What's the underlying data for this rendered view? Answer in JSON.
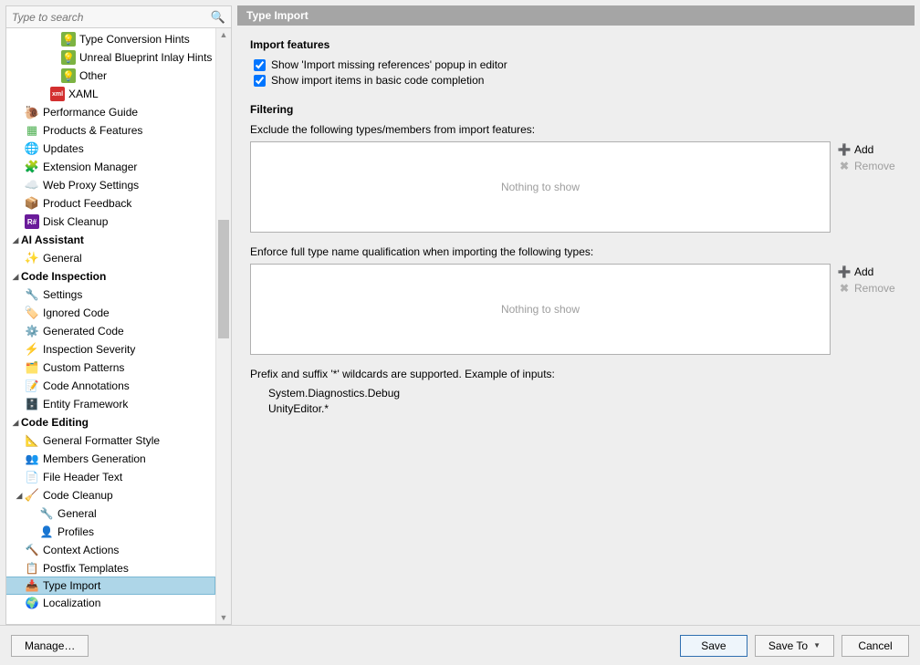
{
  "search": {
    "placeholder": "Type to search"
  },
  "tree": {
    "type_conversion_hints": "Type Conversion Hints",
    "unreal_inlay_hints": "Unreal Blueprint Inlay Hints",
    "other": "Other",
    "xaml": "XAML",
    "performance_guide": "Performance Guide",
    "products_features": "Products & Features",
    "updates": "Updates",
    "extension_manager": "Extension Manager",
    "web_proxy": "Web Proxy Settings",
    "product_feedback": "Product Feedback",
    "disk_cleanup": "Disk Cleanup",
    "ai_assistant": "AI Assistant",
    "ai_general": "General",
    "code_inspection": "Code Inspection",
    "ci_settings": "Settings",
    "ci_ignored": "Ignored Code",
    "ci_generated": "Generated Code",
    "ci_severity": "Inspection Severity",
    "ci_patterns": "Custom Patterns",
    "ci_annotations": "Code Annotations",
    "ci_ef": "Entity Framework",
    "code_editing": "Code Editing",
    "ce_formatter": "General Formatter Style",
    "ce_members": "Members Generation",
    "ce_file_header": "File Header Text",
    "ce_cleanup": "Code Cleanup",
    "ce_cleanup_general": "General",
    "ce_cleanup_profiles": "Profiles",
    "ce_context_actions": "Context Actions",
    "ce_postfix": "Postfix Templates",
    "ce_type_import": "Type Import",
    "ce_localization": "Localization"
  },
  "header": {
    "title": "Type Import"
  },
  "main": {
    "section_import_features": "Import features",
    "check1": "Show 'Import missing references' popup in editor",
    "check2": "Show import items in basic code completion",
    "section_filtering": "Filtering",
    "exclude_desc": "Exclude the following types/members from import features:",
    "nothing_to_show": "Nothing to show",
    "add_label": "Add",
    "remove_label": "Remove",
    "enforce_desc": "Enforce full type name qualification when importing the following types:",
    "hint": "Prefix and suffix '*' wildcards are supported. Example of inputs:",
    "example1": "System.Diagnostics.Debug",
    "example2": "UnityEditor.*"
  },
  "footer": {
    "manage": "Manage…",
    "save": "Save",
    "save_to": "Save To",
    "cancel": "Cancel"
  }
}
